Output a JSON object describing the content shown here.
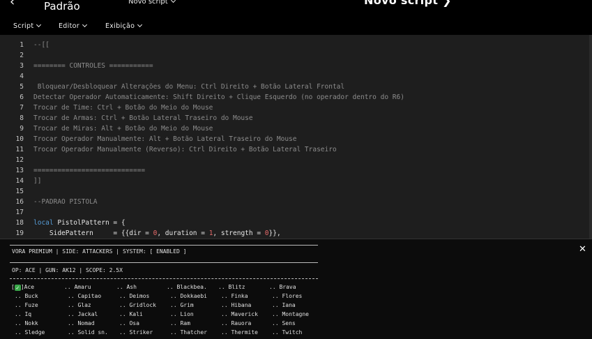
{
  "header": {
    "back_icon": "‹",
    "profile_name": "Padrão",
    "script_dropdown": "Novo script",
    "title": "Novo script ❯"
  },
  "menubar": {
    "items": [
      "Script",
      "Editor",
      "Exibição"
    ]
  },
  "editor": {
    "lines": [
      {
        "n": "1",
        "text": "--[["
      },
      {
        "n": "2",
        "text": ""
      },
      {
        "n": "3",
        "text": "======== CONTROLES ==========="
      },
      {
        "n": "4",
        "text": ""
      },
      {
        "n": "5",
        "text": " Bloquear/Desbloquear Alterações do Menu: Ctrl Direito + Botão Lateral Frontal"
      },
      {
        "n": "6",
        "text": "Detectar Operador Automaticamente: Shift Direito + Clique Esquerdo (no operador dentro do R6)"
      },
      {
        "n": "7",
        "text": "Trocar de Time: Ctrl + Botão do Meio do Mouse"
      },
      {
        "n": "8",
        "text": "Trocar de Armas: Ctrl + Botão Lateral Traseiro do Mouse"
      },
      {
        "n": "9",
        "text": "Trocar de Miras: Alt + Botão do Meio do Mouse"
      },
      {
        "n": "10",
        "text": "Trocar Operador Manualmente: Alt + Botão Lateral Traseiro do Mouse"
      },
      {
        "n": "11",
        "text": "Trocar Operador Manualmente (Reverso): Ctrl Direito + Botão Lateral Traseiro"
      },
      {
        "n": "12",
        "text": ""
      },
      {
        "n": "13",
        "text": "============================"
      },
      {
        "n": "14",
        "text": "]]"
      },
      {
        "n": "15",
        "text": ""
      },
      {
        "n": "16",
        "text": "--PADRAO PISTOLA"
      },
      {
        "n": "17",
        "text": ""
      }
    ],
    "line18": {
      "n": "18",
      "kw": "local",
      "rest": " PistolPattern = {"
    },
    "line19": {
      "n": "19",
      "pre": "    SidePattern     = {{dir = ",
      "v1": "0",
      "mid1": ", duration = ",
      "v2": "1",
      "mid2": ", strength = ",
      "v3": "0",
      "post": "}},"
    }
  },
  "console": {
    "status": "VORA PREMIUM | SIDE: ATTACKERS | SYSTEM: [ ENABLED ]",
    "info": "OP: ACE | GUN: AK12 | SCOPE: 2.5X",
    "close_icon": "✕",
    "selected_prefix": "[",
    "selected_check": "✓",
    "selected_suffix": "]Ace",
    "rows": [
      [
        "",
        ".. Amaru",
        ".. Ash",
        ".. Blackbea.",
        ".. Blitz",
        ".. Brava"
      ],
      [
        ".. Buck",
        ".. Capitao",
        ".. Deimos",
        ".. Dokkaebi",
        ".. Finka",
        ".. Flores"
      ],
      [
        ".. Fuze",
        ".. Glaz",
        ".. Gridlock",
        ".. Grim",
        ".. Hibana",
        ".. Iana"
      ],
      [
        ".. Iq",
        ".. Jackal",
        ".. Kali",
        ".. Lion",
        ".. Maverick",
        ".. Montagne"
      ],
      [
        ".. Nokk",
        ".. Nomad",
        ".. Osa",
        ".. Ram",
        ".. Rauora",
        ".. Sens"
      ],
      [
        ".. Sledge",
        ".. Solid sn.",
        ".. Striker",
        ".. Thatcher",
        ".. Thermite",
        ".. Twitch"
      ]
    ]
  }
}
